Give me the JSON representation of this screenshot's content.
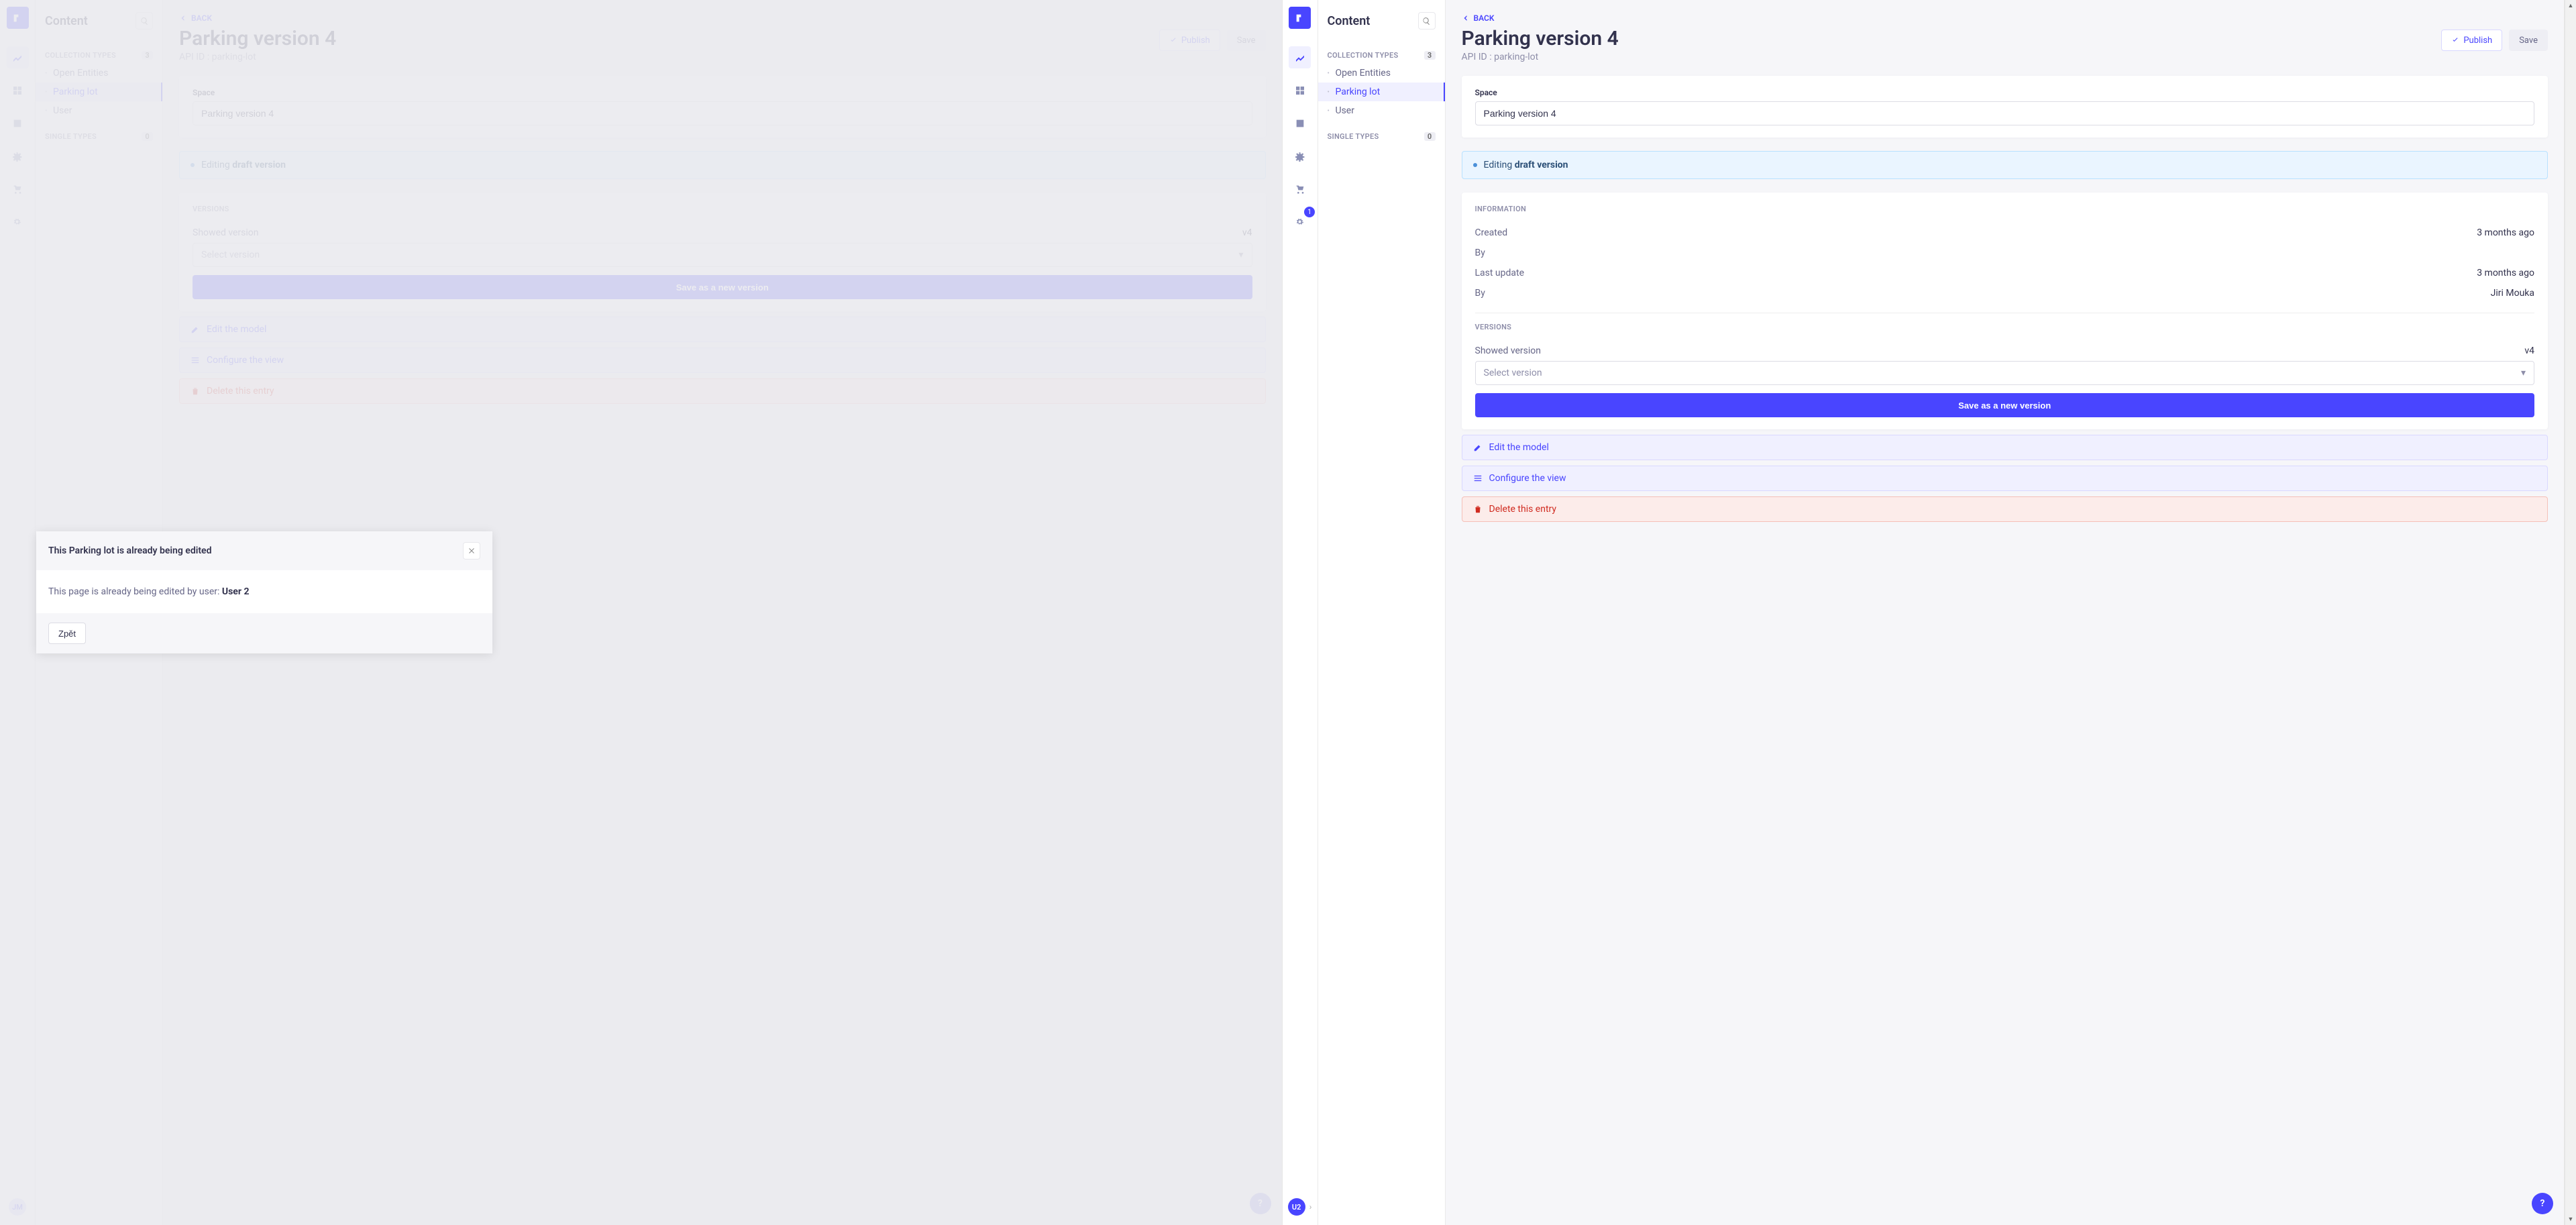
{
  "rail": {
    "settings_badge": "1",
    "avatar_left": "JM",
    "avatar_right": "U2"
  },
  "sidebar": {
    "title": "Content",
    "collection_label": "COLLECTION TYPES",
    "collection_count": "3",
    "single_label": "SINGLE TYPES",
    "single_count": "0",
    "items": [
      {
        "label": "Open Entities"
      },
      {
        "label": "Parking lot"
      },
      {
        "label": "User"
      }
    ]
  },
  "header": {
    "back": "BACK",
    "title": "Parking version 4",
    "api_id_label": "API ID : parking-lot",
    "publish": "Publish",
    "save": "Save"
  },
  "space": {
    "label": "Space",
    "value": "Parking version 4"
  },
  "banner": {
    "prefix": "Editing ",
    "strong": "draft version"
  },
  "info": {
    "section": "INFORMATION",
    "created_k": "Created",
    "created_v": "3 months ago",
    "by_k": "By",
    "last_k": "Last update",
    "last_v": "3 months ago",
    "by2_k": "By",
    "by2_v": "Jiri Mouka"
  },
  "versions": {
    "section": "VERSIONS",
    "showed_k": "Showed version",
    "showed_v": "v4",
    "select_placeholder": "Select version",
    "save_btn": "Save as a new version"
  },
  "actions": {
    "edit": "Edit the model",
    "configure": "Configure the view",
    "delete": "Delete this entry"
  },
  "modal": {
    "title": "This Parking lot is already being edited",
    "body_prefix": "This page is already being edited by user: ",
    "body_user": "User 2",
    "back": "Zpět"
  },
  "fab": "?"
}
